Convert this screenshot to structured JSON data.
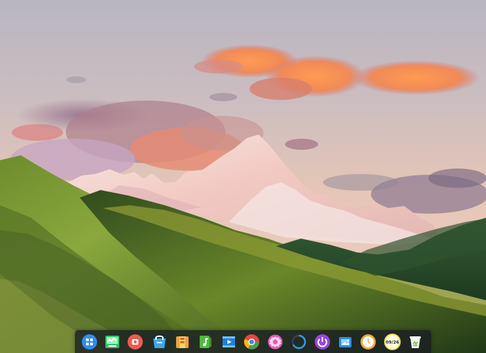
{
  "desktop": {
    "wallpaper": "mountain-sunset-landscape"
  },
  "dock": {
    "items": [
      {
        "name": "launcher",
        "icon": "launcher-icon",
        "color": "#2f8cf0"
      },
      {
        "name": "system-monitor",
        "icon": "system-monitor-icon",
        "color": "#2fc46a"
      },
      {
        "name": "screen-recorder",
        "icon": "screen-recorder-icon",
        "color": "#ee5a54"
      },
      {
        "name": "app-store",
        "icon": "app-store-icon",
        "color": "#3aa7f0"
      },
      {
        "name": "archive-manager",
        "icon": "archive-manager-icon",
        "color": "#f1a33c"
      },
      {
        "name": "music-player",
        "icon": "music-player-icon",
        "color": "#53b83e"
      },
      {
        "name": "video-player",
        "icon": "video-player-icon",
        "color": "#1e7fe0"
      },
      {
        "name": "chrome-browser",
        "icon": "chrome-icon",
        "color": "#e8473c"
      },
      {
        "name": "settings",
        "icon": "settings-gear-icon",
        "color": "#d94bb2"
      },
      {
        "name": "loading-app",
        "icon": "loading-ring-icon",
        "color": "#2e9be8"
      },
      {
        "name": "power",
        "icon": "power-icon",
        "color": "#9a45d8"
      },
      {
        "name": "screenshot",
        "icon": "screenshot-icon",
        "color": "#2b8de3"
      },
      {
        "name": "clock",
        "icon": "clock-icon",
        "color": "#f0a93a"
      },
      {
        "name": "date-time",
        "icon": "date-icon",
        "color": "#eadb5c",
        "text": "09/26"
      },
      {
        "name": "trash",
        "icon": "trash-icon",
        "color": "#7ac04a"
      }
    ]
  }
}
